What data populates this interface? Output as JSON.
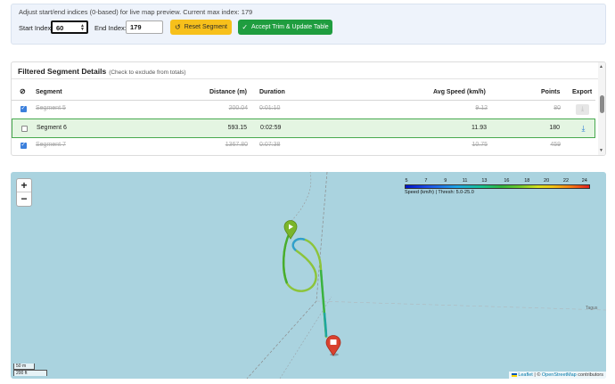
{
  "trim": {
    "hint": "Adjust start/end indices (0-based) for live map preview. Current max index: 179",
    "start_label": "Start Index:",
    "start_value": "60",
    "end_label": "End Index:",
    "end_value": "179",
    "reset_label": "Reset Segment",
    "accept_label": "Accept Trim & Update Table",
    "reset_icon": "undo-icon",
    "accept_icon": "check-icon"
  },
  "segments": {
    "title": "Filtered Segment Details",
    "subtitle": "(Check to exclude from totals)",
    "headers": {
      "exclude_icon": "ban-icon",
      "segment": "Segment",
      "distance": "Distance (m)",
      "duration": "Duration",
      "speed": "Avg Speed (km/h)",
      "points": "Points",
      "export": "Export"
    },
    "rows": [
      {
        "segment": "Segment 5",
        "distance": "200.04",
        "duration": "0:01:10",
        "speed": "9.12",
        "points": "80",
        "excluded": true
      },
      {
        "segment": "Segment 6",
        "distance": "593.15",
        "duration": "0:02:59",
        "speed": "11.93",
        "points": "180",
        "excluded": false
      },
      {
        "segment": "Segment 7",
        "distance": "1367.80",
        "duration": "0:07:38",
        "speed": "10.75",
        "points": "459",
        "excluded": true
      }
    ]
  },
  "map": {
    "zoom_in": "+",
    "zoom_out": "−",
    "legend_ticks": [
      "5",
      "7",
      "9",
      "11",
      "13",
      "16",
      "18",
      "20",
      "22",
      "24"
    ],
    "legend_caption": "Speed (km/h) | Thresh: 5.0-25.0",
    "scale_m": "50 m",
    "scale_ft": "200 ft",
    "attribution_leaflet": "Leaflet",
    "attribution_sep": " | © ",
    "attribution_osm": "OpenStreetMap",
    "attribution_tail": " contributors",
    "place_label": "Tagus"
  }
}
